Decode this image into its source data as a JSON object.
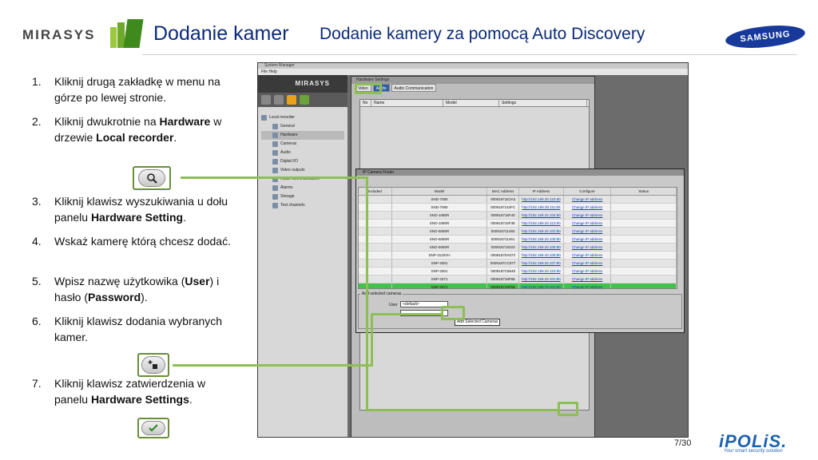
{
  "header": {
    "mirasys_logo": "MIRASYS",
    "title_main": "Dodanie kamer",
    "title_sub": "Dodanie kamery za pomocą Auto Discovery",
    "samsung_logo": "SAMSUNG"
  },
  "steps": [
    {
      "num": "1.",
      "parts": [
        {
          "t": "Kliknij drugą zakładkę w menu na górze po lewej stronie."
        }
      ]
    },
    {
      "num": "2.",
      "parts": [
        {
          "t": "Kliknij dwukrotnie na "
        },
        {
          "t": "Hardware",
          "b": true
        },
        {
          "t": " w drzewie  "
        },
        {
          "t": "Local recorder",
          "b": true
        },
        {
          "t": "."
        }
      ]
    },
    {
      "num": "3.",
      "parts": [
        {
          "t": "Kliknij klawisz wyszukiwania u dołu panelu "
        },
        {
          "t": "Hardware Setting",
          "b": true
        },
        {
          "t": "."
        }
      ]
    },
    {
      "num": "4.",
      "parts": [
        {
          "t": "Wskaż kamerę którą chcesz dodać."
        }
      ]
    },
    {
      "num": "5.",
      "parts": [
        {
          "t": "Wpisz nazwę użytkowika ("
        },
        {
          "t": "User",
          "b": true
        },
        {
          "t": ") i hasło ("
        },
        {
          "t": "Password",
          "b": true
        },
        {
          "t": ")."
        }
      ]
    },
    {
      "num": "6.",
      "parts": [
        {
          "t": "Kliknij klawisz dodania wybranych kamer."
        }
      ]
    },
    {
      "num": "7.",
      "parts": [
        {
          "t": "Kliknij klawisz zatwierdzenia w panelu "
        },
        {
          "t": "Hardware Settings",
          "b": true
        },
        {
          "t": "."
        }
      ]
    }
  ],
  "icons": {
    "search": "search-icon",
    "add": "add-camera-icon",
    "confirm": "checkmark-icon"
  },
  "app": {
    "menu": "File   Help",
    "brand": "MIRASYS",
    "tree": [
      {
        "label": "Local recorder",
        "indent": false
      },
      {
        "label": "General",
        "indent": true
      },
      {
        "label": "Hardware",
        "indent": true
      },
      {
        "label": "Cameras",
        "indent": true
      },
      {
        "label": "Audio",
        "indent": true
      },
      {
        "label": "Digital I/O",
        "indent": true
      },
      {
        "label": "Video outputs",
        "indent": true
      },
      {
        "label": "Audio Communication",
        "indent": true
      },
      {
        "label": "Alarms",
        "indent": true
      },
      {
        "label": "Storage",
        "indent": true
      },
      {
        "label": "Text channels",
        "indent": true
      }
    ],
    "hw_panel": {
      "title": "Hardware Settings",
      "tabs": [
        "Video",
        "Audio",
        "Audio Communication"
      ],
      "columns": [
        "No",
        "Name",
        "Model",
        "Settings"
      ]
    },
    "finder": {
      "title": "IP Camera Finder",
      "columns": [
        "Included",
        "Model",
        "MAC Address",
        "IP Address",
        "Configure",
        "Status"
      ],
      "rows": [
        {
          "model": "SND-7080",
          "mac": "00091871E3A3",
          "ip": "http://192.168.30.110:80",
          "cfg": "Change IP address"
        },
        {
          "model": "SND-7080",
          "mac": "0009187142FC",
          "ip": "http://192.168.30.111:80",
          "cfg": "Change IP address"
        },
        {
          "model": "SNO-1080R",
          "mac": "000918716F40",
          "ip": "http://192.168.20.104:80",
          "cfg": "Change IP address"
        },
        {
          "model": "SNO-1080R",
          "mac": "000918716F3E",
          "ip": "http://192.168.20.112:80",
          "cfg": "Change IP address"
        },
        {
          "model": "SNO-5080R",
          "mac": "000918711460",
          "ip": "http://192.168.20.102:80",
          "cfg": "Change IP address"
        },
        {
          "model": "SNO-5080R",
          "mac": "000918711461",
          "ip": "http://192.168.20.105:80",
          "cfg": "Change IP address"
        },
        {
          "model": "SNO-5080R",
          "mac": "000918710423",
          "ip": "http://192.168.20.106:80",
          "cfg": "Change IP address"
        },
        {
          "model": "SNP-3120VH",
          "mac": "00091870A673",
          "ip": "http://192.168.40.106:80",
          "cfg": "Change IP address"
        },
        {
          "model": "SNP-3301",
          "mac": "0009187CC877",
          "ip": "http://192.168.20.107:80",
          "cfg": "Change IP address"
        },
        {
          "model": "SNP-3301",
          "mac": "0009187C8648",
          "ip": "http://192.168.20.110:80",
          "cfg": "Change IP address"
        },
        {
          "model": "SNP-3371",
          "mac": "000918718F5E",
          "ip": "http://192.168.20.101:80",
          "cfg": "Change IP address"
        },
        {
          "model": "SNP-3371",
          "mac": "000918718F6D",
          "ip": "http://192.168.70.101:80",
          "cfg": "Change IP address",
          "selected": true
        }
      ],
      "add_group_label": "Add selected cameras",
      "user_label": "User",
      "user_value": "<default>",
      "tooltip": "Add Selected Cameras"
    }
  },
  "footer": {
    "page": "7/30",
    "ipolis": "iPOLiS.",
    "ipolis_tag": "Your smart security solution"
  },
  "colors": {
    "accent": "#8dbf55",
    "title": "#0b2a7a",
    "ipolis": "#1e62b0"
  }
}
